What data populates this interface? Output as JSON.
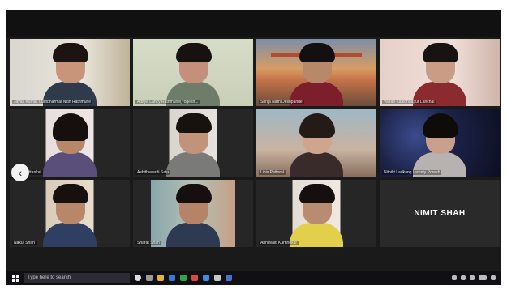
{
  "nav": {
    "prev_arrow": "‹"
  },
  "tiles": [
    {
      "id": "t1",
      "name": "Jayas Kumar Cumbharmal Nitin Rathmurle"
    },
    {
      "id": "t2",
      "name": "Aditya Lancy Rathmurle(Yogesh..."
    },
    {
      "id": "t3",
      "name": "Shrija Nath Deshpande"
    },
    {
      "id": "t4",
      "name": "Vairab Kaikondapur Lanchal"
    },
    {
      "id": "t5",
      "name": "Sofia Pattankal"
    },
    {
      "id": "t6",
      "name": "Ashithveerdi Satu"
    },
    {
      "id": "t7",
      "name": "Linis Pattoral"
    },
    {
      "id": "t8",
      "name": "Nithiltt Ladkang Lumnty Poresh"
    },
    {
      "id": "t9",
      "name": "Nakul Shah"
    },
    {
      "id": "t10",
      "name": "Sharat Shah"
    },
    {
      "id": "t11",
      "name": "Abhuvalti Kurhhokar"
    },
    {
      "id": "t12",
      "name": "",
      "display_name": "NIMIT SHAH"
    }
  ],
  "taskbar": {
    "search_placeholder": "Type here to search"
  },
  "colors": {
    "active_border": "#b9c98a",
    "background": "#1a1a1a"
  }
}
